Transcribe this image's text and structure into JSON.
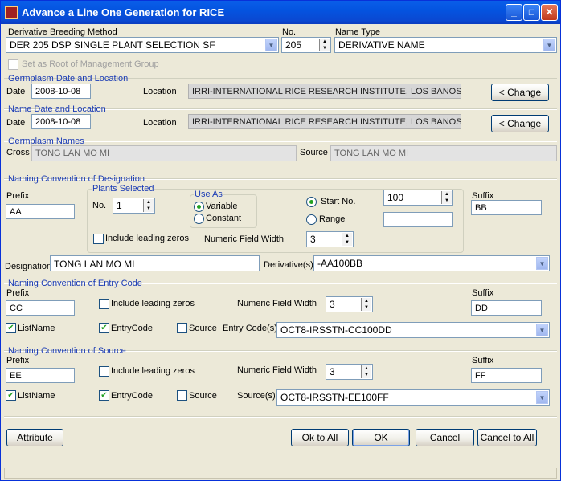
{
  "window": {
    "title": "Advance a Line One Generation for RICE"
  },
  "header": {
    "derivative_breeding_method_label": "Derivative Breeding Method",
    "derivative_breeding_method_value": "DER  205 DSP SINGLE PLANT SELECTION SF",
    "no_label": "No.",
    "no_value": "205",
    "name_type_label": "Name Type",
    "name_type_value": "DERIVATIVE NAME",
    "set_root_label": "Set as Root of Management Group"
  },
  "germplasm_date_location": {
    "title": "Germplasm Date and Location",
    "date_label": "Date",
    "date_value": "2008-10-08",
    "location_label": "Location",
    "location_value": "IRRI-INTERNATIONAL RICE RESEARCH INSTITUTE, LOS BANOS",
    "change_label": "< Change"
  },
  "name_date_location": {
    "title": "Name Date and Location",
    "date_label": "Date",
    "date_value": "2008-10-08",
    "location_label": "Location",
    "location_value": "IRRI-INTERNATIONAL RICE RESEARCH INSTITUTE, LOS BANOS",
    "change_label": "< Change"
  },
  "germplasm_names": {
    "title": "Germplasm Names",
    "cross_label": "Cross",
    "cross_value": "TONG LAN MO MI",
    "source_label": "Source",
    "source_value": "TONG LAN MO MI"
  },
  "designation_convention": {
    "title": "Naming Convention of Designation",
    "prefix_label": "Prefix",
    "prefix_value": "AA",
    "plants_selected_title": "Plants Selected",
    "no_label": "No.",
    "no_value": "1",
    "use_as_title": "Use As",
    "variable_label": "Variable",
    "constant_label": "Constant",
    "start_no_label": "Start No.",
    "start_no_value": "100",
    "range_label": "Range",
    "range_value": "",
    "include_leading_zeros_label": "Include leading zeros",
    "numeric_field_width_label": "Numeric Field Width",
    "numeric_field_width_value": "3",
    "suffix_label": "Suffix",
    "suffix_value": "BB",
    "designation_label": "Designation",
    "designation_value": "TONG LAN MO MI",
    "derivatives_label": "Derivative(s)",
    "derivatives_value": "-AA100BB"
  },
  "entry_code_convention": {
    "title": "Naming Convention of Entry Code",
    "prefix_label": "Prefix",
    "prefix_value": "CC",
    "include_leading_zeros_label": "Include leading zeros",
    "numeric_field_width_label": "Numeric Field Width",
    "numeric_field_width_value": "3",
    "suffix_label": "Suffix",
    "suffix_value": "DD",
    "listname_label": "ListName",
    "entrycode_label": "EntryCode",
    "source_label": "Source",
    "entry_codes_label": "Entry Code(s)",
    "entry_codes_value": "OCT8-IRSSTN-CC100DD"
  },
  "source_convention": {
    "title": "Naming Convention of Source",
    "prefix_label": "Prefix",
    "prefix_value": "EE",
    "include_leading_zeros_label": "Include leading zeros",
    "numeric_field_width_label": "Numeric Field Width",
    "numeric_field_width_value": "3",
    "suffix_label": "Suffix",
    "suffix_value": "FF",
    "listname_label": "ListName",
    "entrycode_label": "EntryCode",
    "source_label": "Source",
    "sources_label": "Source(s)",
    "sources_value": "OCT8-IRSSTN-EE100FF"
  },
  "buttons": {
    "attribute": "Attribute",
    "ok_to_all": "Ok to All",
    "ok": "OK",
    "cancel": "Cancel",
    "cancel_to_all": "Cancel to All"
  },
  "colors": {
    "title_bar": "#0a5ee9",
    "section_title": "#1a3bb5",
    "dialog_bg": "#ece9d8",
    "checkmark": "#21a121"
  }
}
